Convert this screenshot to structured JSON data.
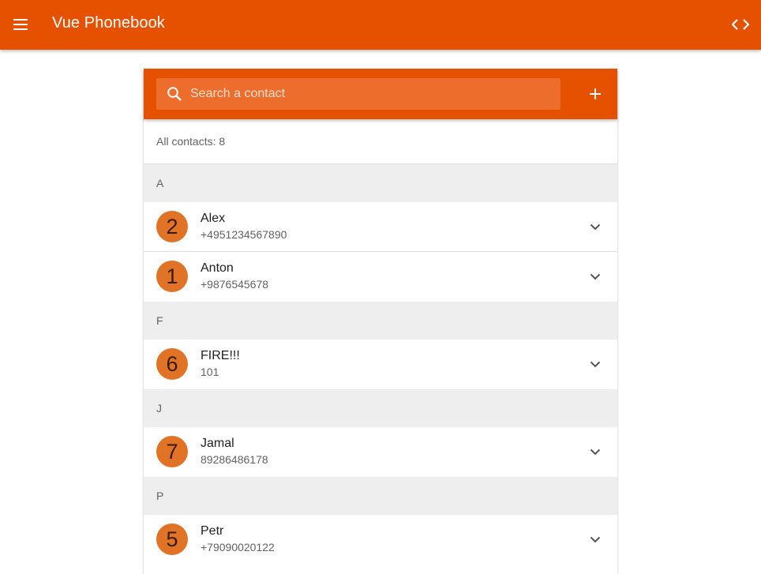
{
  "app": {
    "title": "Vue Phonebook"
  },
  "icons": {
    "menu": "menu-icon",
    "code": "code-icon",
    "search": "search-icon",
    "add": "plus-icon",
    "expand": "chevron-down-icon"
  },
  "colors": {
    "primary": "#e65100",
    "search_bg": "#ec6d2c",
    "avatar": "#e07325",
    "section_bg": "#eeeeee"
  },
  "search": {
    "placeholder": "Search a contact",
    "value": ""
  },
  "count_label": "All contacts: 8",
  "sections": [
    {
      "letter": "A",
      "contacts": [
        {
          "avatar": "2",
          "name": "Alex",
          "phone": "+4951234567890"
        },
        {
          "avatar": "1",
          "name": "Anton",
          "phone": "+9876545678"
        }
      ]
    },
    {
      "letter": "F",
      "contacts": [
        {
          "avatar": "6",
          "name": "FIRE!!!",
          "phone": "101"
        }
      ]
    },
    {
      "letter": "J",
      "contacts": [
        {
          "avatar": "7",
          "name": "Jamal",
          "phone": "89286486178"
        }
      ]
    },
    {
      "letter": "P",
      "contacts": [
        {
          "avatar": "5",
          "name": "Petr",
          "phone": "+79090020122"
        }
      ]
    }
  ]
}
